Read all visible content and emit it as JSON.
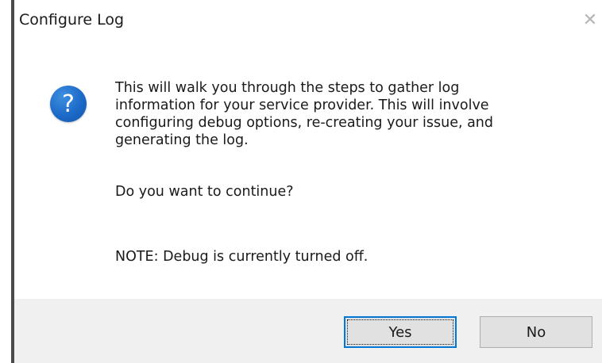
{
  "dialog": {
    "title": "Configure Log",
    "close_glyph": "✕",
    "icon": "question-icon",
    "icon_glyph": "?",
    "message_lines": [
      "This will walk you through the steps to gather log",
      "information for your service provider. This will involve",
      "configuring debug options, re-creating your issue, and",
      "generating the log."
    ],
    "question": "Do you want to continue?",
    "note": "NOTE: Debug is currently turned off.",
    "buttons": {
      "yes_label": "Yes",
      "no_label": "No"
    }
  }
}
